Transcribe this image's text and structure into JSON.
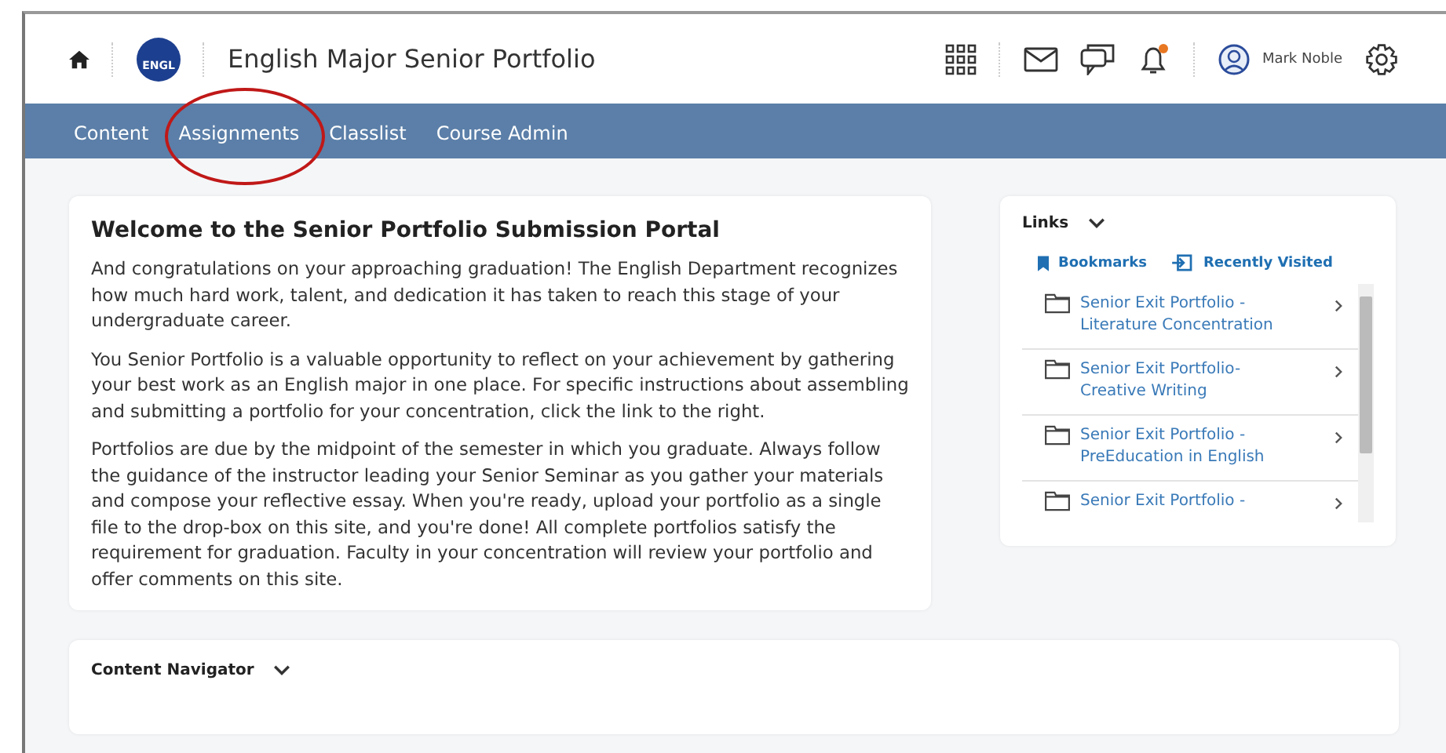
{
  "header": {
    "course_badge": "ENGL",
    "title": "English Major Senior Portfolio",
    "user_name": "Mark Noble",
    "notification_dot": true
  },
  "nav": [
    {
      "label": "Content",
      "circled": false
    },
    {
      "label": "Assignments",
      "circled": true
    },
    {
      "label": "Classlist",
      "circled": false
    },
    {
      "label": "Course Admin",
      "circled": false
    }
  ],
  "welcome": {
    "title": "Welcome to the Senior Portfolio Submission Portal",
    "paragraphs": [
      "And congratulations on your approaching graduation! The English Department recognizes how much hard work, talent, and dedication it has taken to reach this stage of your undergraduate career.",
      "You Senior Portfolio is a valuable opportunity to reflect on your achievement by gathering your best work as an English major in one place. For specific instructions about assembling and submitting a portfolio for your concentration, click the link to the right.",
      "Portfolios are due by the midpoint of the semester in which you graduate. Always follow the guidance of the instructor leading your Senior Seminar as you gather your materials and compose your reflective essay. When you're ready, upload your portfolio as a single file to the drop-box on this site, and you're done! All complete portfolios satisfy the requirement for graduation. Faculty in your concentration will review your portfolio and offer comments on this site."
    ]
  },
  "links": {
    "title": "Links",
    "tabs": [
      "Bookmarks",
      "Recently Visited"
    ],
    "items": [
      {
        "lines": [
          "Senior Exit Portfolio -",
          "Literature Concentration"
        ]
      },
      {
        "lines": [
          "Senior Exit Portfolio-",
          "Creative Writing"
        ]
      },
      {
        "lines": [
          "Senior Exit Portfolio -",
          "PreEducation in English"
        ]
      },
      {
        "lines": [
          "Senior Exit Portfolio -"
        ]
      }
    ]
  },
  "content_navigator": {
    "title": "Content Navigator"
  }
}
